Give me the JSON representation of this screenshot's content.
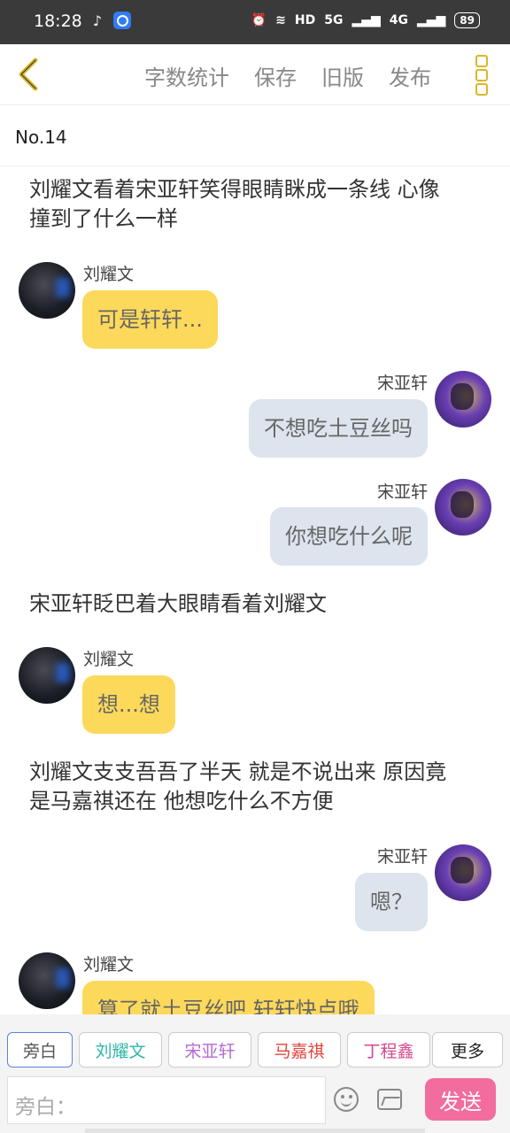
{
  "status_bar": {
    "time": "18:28",
    "network": "HD",
    "signal1": "5G",
    "signal2": "4G",
    "battery": "89"
  },
  "toolbar": {
    "actions": [
      "字数统计",
      "保存",
      "旧版",
      "发布"
    ]
  },
  "chapter": "No.14",
  "colors": {
    "accent_yellow": "#fdd95b",
    "bubble_gray": "#dde4ee",
    "send_pink": "#f26d9e",
    "more_icon_gold": "#d8b829"
  },
  "messages": [
    {
      "type": "narration",
      "text1": "刘耀文看着宋亚轩笑得眼睛眯成一条线 心像",
      "text2": "撞到了什么一样"
    },
    {
      "type": "left",
      "speaker": "刘耀文",
      "text": "可是轩轩..."
    },
    {
      "type": "right",
      "speaker": "宋亚轩",
      "text": "不想吃土豆丝吗"
    },
    {
      "type": "right",
      "speaker": "宋亚轩",
      "text": "你想吃什么呢"
    },
    {
      "type": "narration",
      "text1": "宋亚轩眨巴着大眼睛看着刘耀文"
    },
    {
      "type": "left",
      "speaker": "刘耀文",
      "text": "想...想"
    },
    {
      "type": "narration",
      "text1": "刘耀文支支吾吾了半天 就是不说出来 原因竟",
      "text2": "是马嘉祺还在 他想吃什么不方便"
    },
    {
      "type": "right",
      "speaker": "宋亚轩",
      "text": "嗯？"
    },
    {
      "type": "left",
      "speaker": "刘耀文",
      "text": "算了就土豆丝吧 轩轩快点哦"
    }
  ],
  "roles": [
    {
      "label": "旁白",
      "color": "#555555"
    },
    {
      "label": "刘耀文",
      "color": "#2fb6a7"
    },
    {
      "label": "宋亚轩",
      "color": "#b46ad6"
    },
    {
      "label": "马嘉祺",
      "color": "#e0443c"
    },
    {
      "label": "丁程鑫",
      "color": "#d4488e"
    },
    {
      "label": "更多",
      "color": "#555555"
    }
  ],
  "input": {
    "placeholder": "旁白："
  },
  "send_label": "发送"
}
